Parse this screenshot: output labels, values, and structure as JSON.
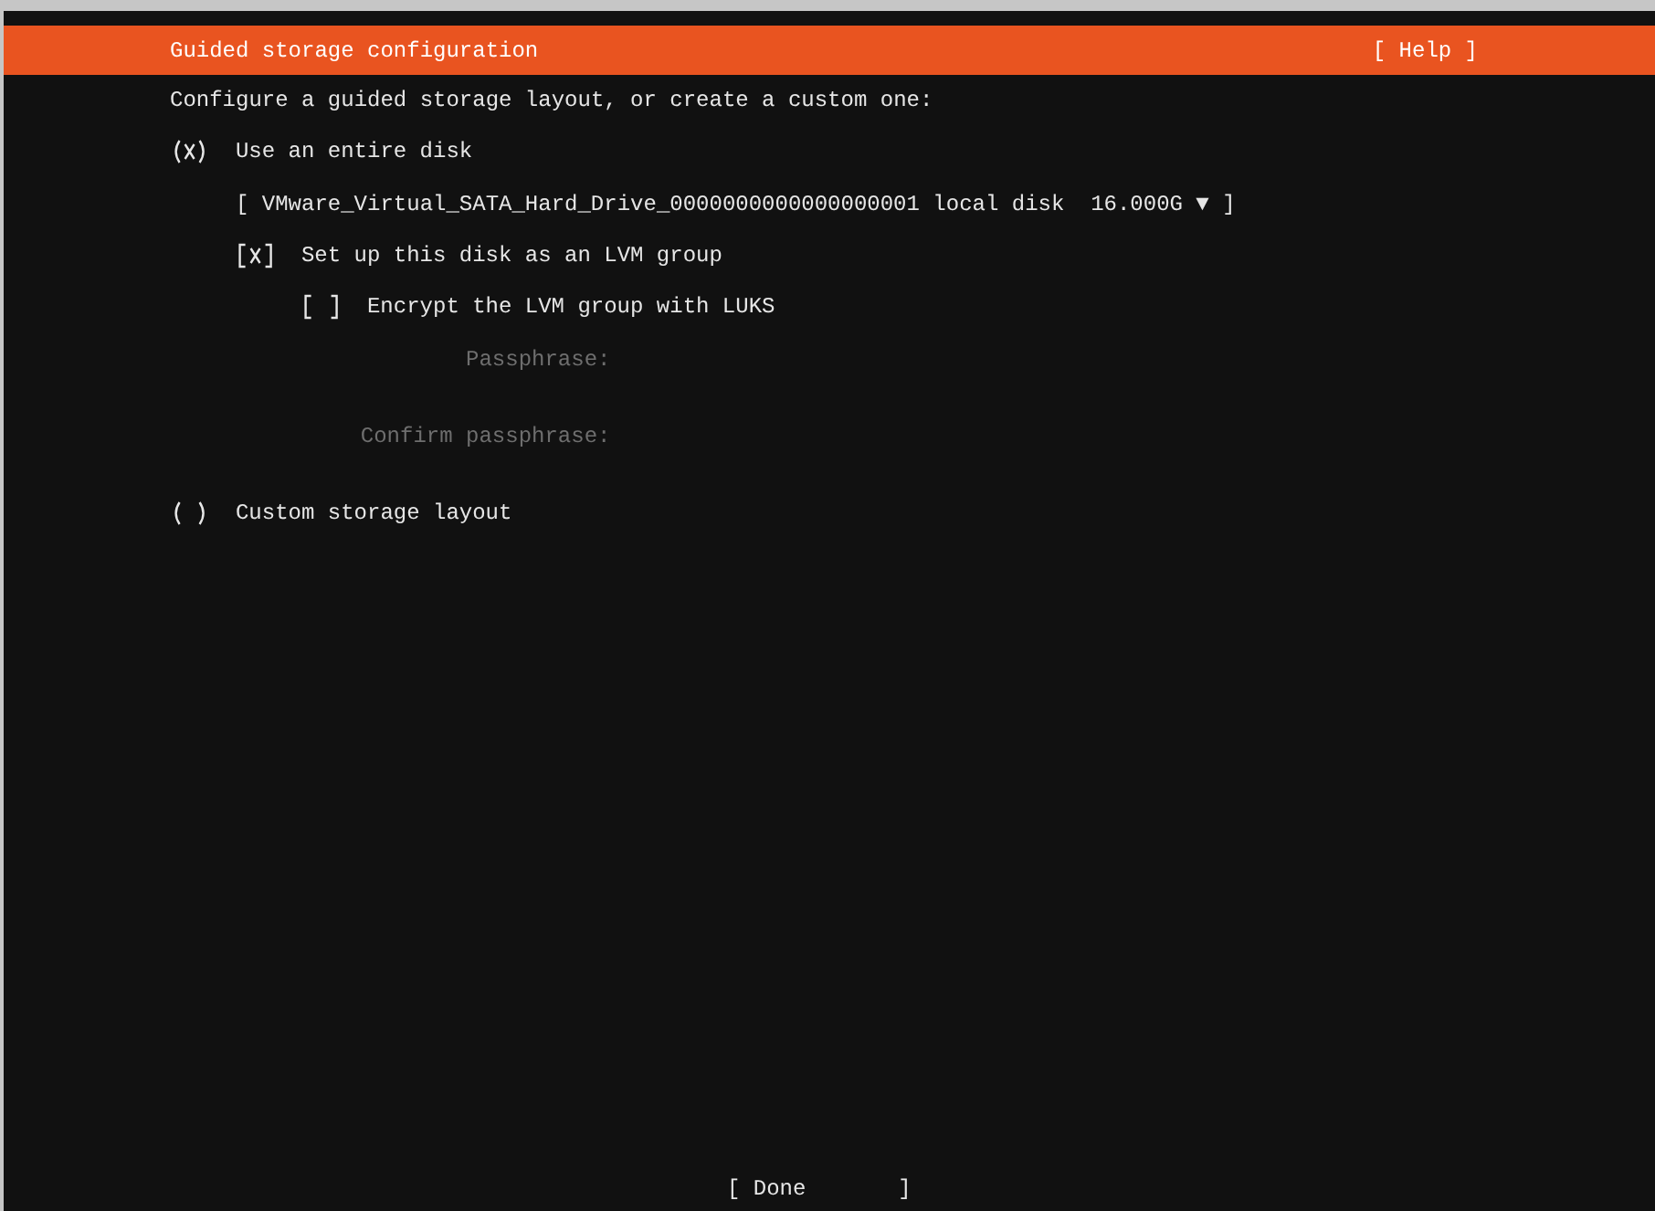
{
  "header": {
    "title": "Guided storage configuration",
    "help_button": "[ Help ]"
  },
  "intro": "Configure a guided storage layout, or create a custom one:",
  "entire_disk": {
    "label": "Use an entire disk",
    "selected": true
  },
  "disk_dropdown": {
    "label": "[ VMware_Virtual_SATA_Hard_Drive_0000000000000000001 local disk  16.000G ▼ ]"
  },
  "lvm": {
    "label": "Set up this disk as an LVM group",
    "checked": true
  },
  "encrypt": {
    "label": "Encrypt the LVM group with LUKS",
    "checked": false
  },
  "passphrase_fields": [
    {
      "label": "Passphrase:",
      "disabled": true
    },
    {
      "label": "Confirm passphrase:",
      "disabled": true
    }
  ],
  "custom_layout": {
    "label": "Custom storage layout",
    "selected": false
  },
  "buttons": [
    "[ Done       ]"
  ]
}
